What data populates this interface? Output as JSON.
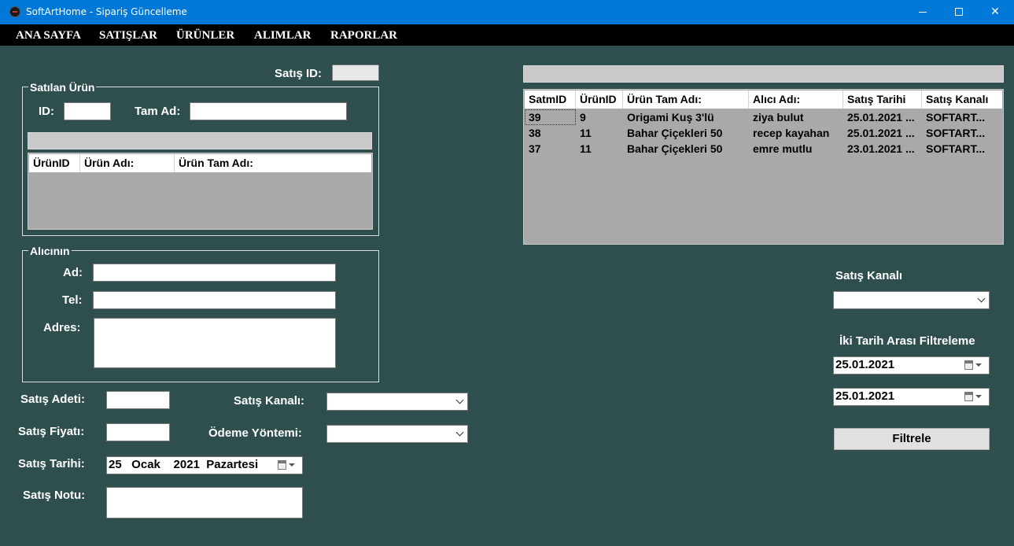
{
  "window": {
    "title": "SoftArtHome - Sipariş Güncelleme"
  },
  "menu": [
    "ANA SAYFA",
    "SATIŞLAR",
    "ÜRÜNLER",
    "ALIMLAR",
    "RAPORLAR"
  ],
  "form": {
    "satis_id_label": "Satış ID:",
    "satilan_urun": {
      "group_title": "Satılan Ürün",
      "id_label": "ID:",
      "tam_ad_label": "Tam Ad:",
      "columns": [
        "ÜrünID",
        "Ürün Adı:",
        "Ürün Tam Adı:"
      ]
    },
    "alici": {
      "group_title": "Alıcının",
      "ad_label": "Ad:",
      "tel_label": "Tel:",
      "adres_label": "Adres:"
    },
    "satis_adeti_label": "Satış Adeti:",
    "satis_fiyati_label": "Satış Fiyatı:",
    "satis_tarihi_label": "Satış Tarihi:",
    "satis_notu_label": "Satış Notu:",
    "satis_kanali_label": "Satış Kanalı:",
    "odeme_yontemi_label": "Ödeme Yöntemi:",
    "satis_tarihi_value": "25   Ocak    2021  Pazartesi"
  },
  "sales_grid": {
    "columns": [
      "SatmID",
      "ÜrünID",
      "Ürün Tam Adı:",
      "Alıcı Adı:",
      "Satış Tarihi",
      "Satış Kanalı"
    ],
    "rows": [
      [
        "39",
        "9",
        "Origami Kuş 3'lü",
        "ziya bulut",
        "25.01.2021 ...",
        "SOFTART..."
      ],
      [
        "38",
        "11",
        "Bahar Çiçekleri 50",
        "recep kayahan",
        "25.01.2021 ...",
        "SOFTART..."
      ],
      [
        "37",
        "11",
        "Bahar Çiçekleri 50",
        "emre mutlu",
        "23.01.2021 ...",
        "SOFTART..."
      ]
    ]
  },
  "filter": {
    "satis_kanali_label": "Satış Kanalı",
    "date_range_label": "İki Tarih Arası Filtreleme",
    "date_from": "25.01.2021",
    "date_to": "25.01.2021",
    "filter_button": "Filtrele"
  }
}
